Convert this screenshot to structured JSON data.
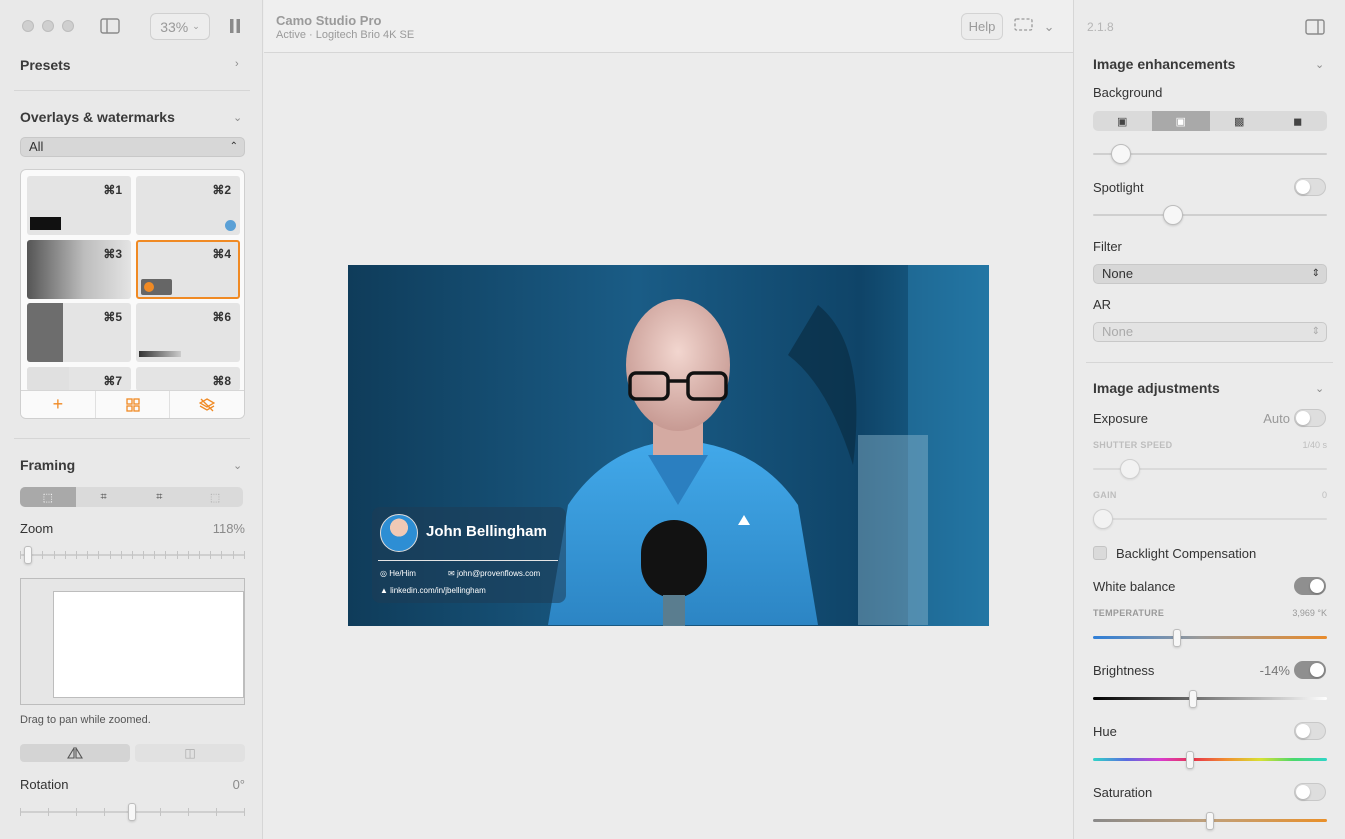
{
  "toolbar": {
    "zoom_level": "33%",
    "app_title": "Camo Studio Pro",
    "app_subtitle": "Active · Logitech Brio 4K SE",
    "help_label": "Help"
  },
  "left": {
    "presets_title": "Presets",
    "overlays_title": "Overlays & watermarks",
    "overlay_filter": "All",
    "overlay_keys": [
      "⌘1",
      "⌘2",
      "⌘3",
      "⌘4",
      "⌘5",
      "⌘6",
      "⌘7",
      "⌘8"
    ],
    "framing_title": "Framing",
    "zoom_label": "Zoom",
    "zoom_value": "118%",
    "pan_hint": "Drag to pan while zoomed.",
    "rotation_label": "Rotation",
    "rotation_value": "0°"
  },
  "preview": {
    "name": "John Bellingham",
    "pronouns": "He/Him",
    "email": "john@provenflows.com",
    "linkedin": "linkedin.com/in/jbellingham"
  },
  "right": {
    "version": "2.1.8",
    "enhancements_title": "Image enhancements",
    "background_label": "Background",
    "spotlight_label": "Spotlight",
    "filter_label": "Filter",
    "filter_value": "None",
    "ar_label": "AR",
    "ar_value": "None",
    "adjustments_title": "Image adjustments",
    "exposure_label": "Exposure",
    "exposure_auto": "Auto",
    "shutter_label": "SHUTTER SPEED",
    "shutter_value": "1/40 s",
    "gain_label": "GAIN",
    "gain_value": "0",
    "backlight_label": "Backlight Compensation",
    "white_balance_label": "White balance",
    "temperature_label": "TEMPERATURE",
    "temperature_value": "3,969 °K",
    "brightness_label": "Brightness",
    "brightness_value": "-14%",
    "hue_label": "Hue",
    "saturation_label": "Saturation"
  }
}
